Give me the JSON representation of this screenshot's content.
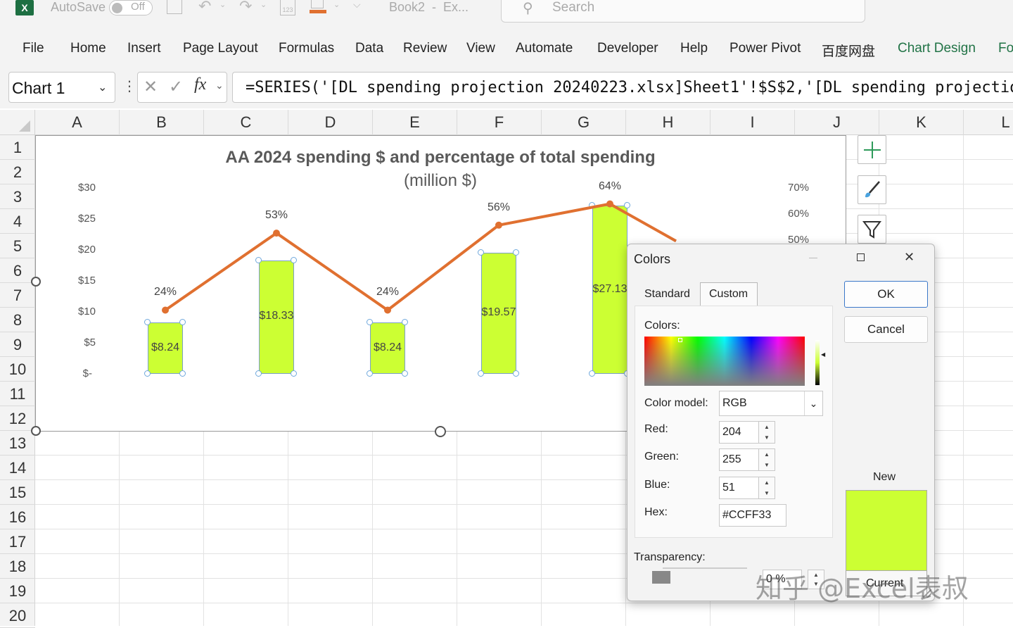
{
  "titlebar": {
    "autosave_label": "AutoSave",
    "autosave_state": "Off",
    "doc_title": "Book2  -  Ex...",
    "search_placeholder": "Search"
  },
  "ribbon": {
    "tabs": [
      "File",
      "Home",
      "Insert",
      "Page Layout",
      "Formulas",
      "Data",
      "Review",
      "View",
      "Automate",
      "Developer",
      "Help",
      "Power Pivot",
      "百度网盘",
      "Chart Design",
      "Fo"
    ],
    "active_tab": "Chart Design",
    "accent": "#217346"
  },
  "formula_bar": {
    "name_box": "Chart 1",
    "fx": "fx",
    "formula": "=SERIES('[DL spending projection 20240223.xlsx]Sheet1'!$S$2,'[DL spending projection"
  },
  "columns": [
    "A",
    "B",
    "C",
    "D",
    "E",
    "F",
    "G",
    "H",
    "I",
    "J",
    "K",
    "L"
  ],
  "rows": [
    "1",
    "2",
    "3",
    "4",
    "5",
    "6",
    "7",
    "8",
    "9",
    "10",
    "11",
    "12",
    "13",
    "14",
    "15",
    "16",
    "17",
    "18",
    "19",
    "20"
  ],
  "chart_data": {
    "type": "bar",
    "title": "AA 2024 spending $ and percentage of total spending",
    "subtitle": "(million $)",
    "categories": [
      "",
      "",
      "",
      "",
      ""
    ],
    "series": [
      {
        "type": "bar",
        "values": [
          8.24,
          18.33,
          8.24,
          19.57,
          27.13
        ],
        "labels": [
          "$8.24",
          "$18.33",
          "$8.24",
          "$19.57",
          "$27.13"
        ],
        "color": "#CCFF33"
      },
      {
        "type": "line",
        "values": [
          24,
          53,
          24,
          56,
          64
        ],
        "labels": [
          "24%",
          "53%",
          "24%",
          "56%",
          "64%"
        ],
        "color": "#E07030"
      }
    ],
    "y_ticks": [
      "$30",
      "$25",
      "$20",
      "$15",
      "$10",
      "$5",
      "$-"
    ],
    "y2_ticks": [
      "70%",
      "60%",
      "50%"
    ],
    "ylim": [
      0,
      30
    ],
    "y2lim": [
      0,
      70
    ]
  },
  "dialog": {
    "title": "Colors",
    "tab_standard": "Standard",
    "tab_custom": "Custom",
    "colors_label": "Colors:",
    "color_model_label": "Color model:",
    "color_model_value": "RGB",
    "red_label": "Red:",
    "red_value": "204",
    "green_label": "Green:",
    "green_value": "255",
    "blue_label": "Blue:",
    "blue_value": "51",
    "hex_label": "Hex:",
    "hex_value": "#CCFF33",
    "transparency_label": "Transparency:",
    "transparency_value": "0 %",
    "ok": "OK",
    "cancel": "Cancel",
    "new_label": "New",
    "current_label": "Current",
    "new_color": "#CCFF33"
  },
  "watermark": "知乎 @Excel表叔"
}
